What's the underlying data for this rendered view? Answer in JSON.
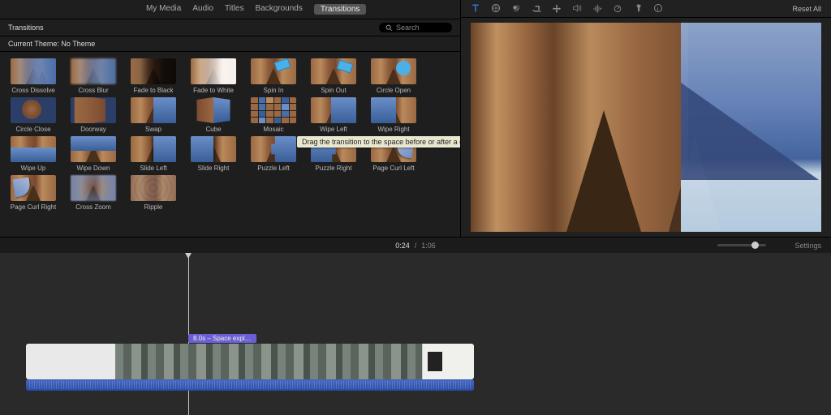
{
  "tabs": {
    "my_media": "My Media",
    "audio": "Audio",
    "titles": "Titles",
    "backgrounds": "Backgrounds",
    "transitions": "Transitions"
  },
  "header": {
    "panel_title": "Transitions",
    "search_placeholder": "Search"
  },
  "theme": {
    "label": "Current Theme: No Theme"
  },
  "tooltip": "Drag the transition to the space before or after a clip",
  "transitions": [
    {
      "id": "cross-dissolve",
      "label": "Cross Dissolve"
    },
    {
      "id": "cross-blur",
      "label": "Cross Blur"
    },
    {
      "id": "fade-to-black",
      "label": "Fade to Black"
    },
    {
      "id": "fade-to-white",
      "label": "Fade to White"
    },
    {
      "id": "spin-in",
      "label": "Spin In"
    },
    {
      "id": "spin-out",
      "label": "Spin Out"
    },
    {
      "id": "circle-open",
      "label": "Circle Open"
    },
    {
      "id": "circle-close",
      "label": "Circle Close"
    },
    {
      "id": "doorway",
      "label": "Doorway"
    },
    {
      "id": "swap",
      "label": "Swap"
    },
    {
      "id": "cube",
      "label": "Cube"
    },
    {
      "id": "mosaic",
      "label": "Mosaic"
    },
    {
      "id": "wipe-left",
      "label": "Wipe Left"
    },
    {
      "id": "wipe-right",
      "label": "Wipe Right"
    },
    {
      "id": "wipe-up",
      "label": "Wipe Up"
    },
    {
      "id": "wipe-down",
      "label": "Wipe Down"
    },
    {
      "id": "slide-left",
      "label": "Slide Left"
    },
    {
      "id": "slide-right",
      "label": "Slide Right"
    },
    {
      "id": "puzzle-left",
      "label": "Puzzle Left"
    },
    {
      "id": "puzzle-right",
      "label": "Puzzle Right"
    },
    {
      "id": "page-curl-left",
      "label": "Page Curl Left"
    },
    {
      "id": "page-curl-right",
      "label": "Page Curl Right"
    },
    {
      "id": "cross-zoom",
      "label": "Cross Zoom"
    },
    {
      "id": "ripple",
      "label": "Ripple"
    }
  ],
  "viewer": {
    "reset": "Reset All"
  },
  "timeline": {
    "current": "0:24",
    "sep": "/",
    "total": "1:06",
    "settings": "Settings",
    "clip_label": "8.0s – Space expl…"
  }
}
